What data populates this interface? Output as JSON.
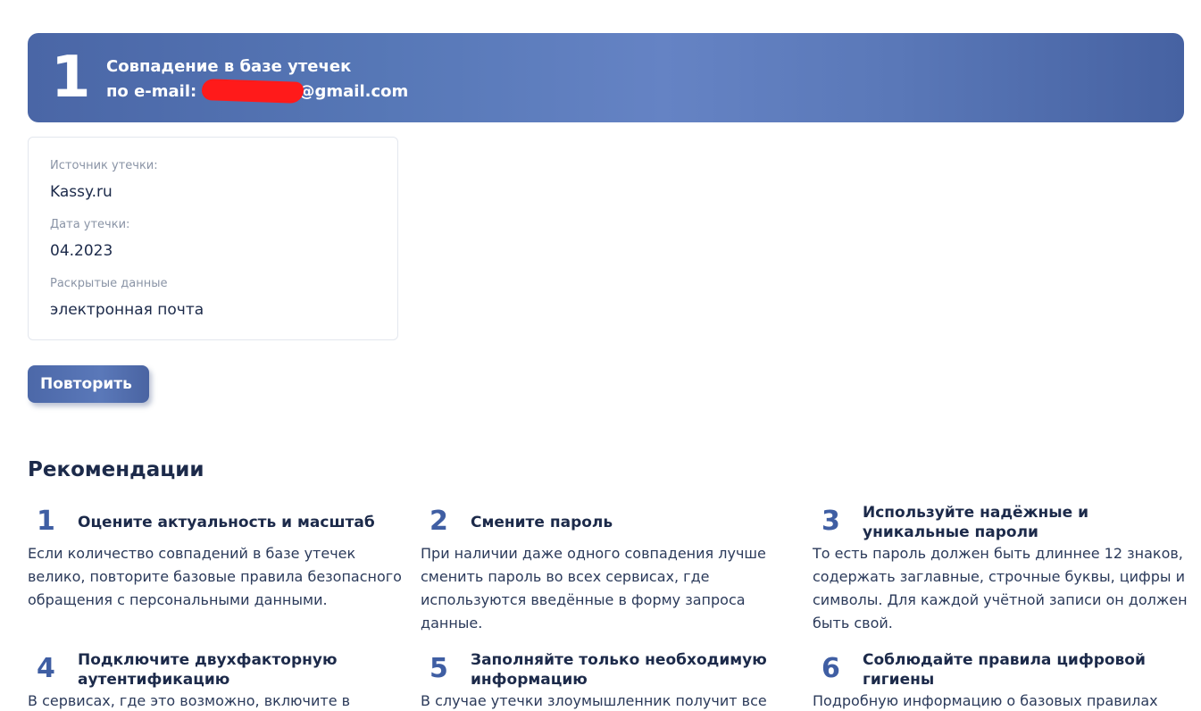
{
  "result": {
    "number": "1",
    "title_line1": "Совпадение в базе утечек",
    "title_prefix": "по e-mail:",
    "email_suffix": "@gmail.com"
  },
  "details": {
    "source_label": "Источник утечки:",
    "source_value": "Kassy.ru",
    "date_label": "Дата утечки:",
    "date_value": "04.2023",
    "data_label": "Раскрытые данные",
    "data_value": "электронная почта"
  },
  "actions": {
    "retry_label": "Повторить"
  },
  "recommendations": {
    "title": "Рекомендации",
    "items": [
      {
        "num": "1",
        "heading": "Оцените актуальность и масштаб",
        "text": "Если количество совпадений в базе утечек велико, повторите базовые правила безопасного обращения с персональными данными."
      },
      {
        "num": "2",
        "heading": "Смените пароль",
        "text": "При наличии даже одного совпадения лучше сменить пароль во всех сервисах, где используются введённые в форму запроса данные."
      },
      {
        "num": "3",
        "heading": "Используйте надёжные и уникальные пароли",
        "text": "То есть пароль должен быть длиннее 12 знаков, содержать заглавные, строчные буквы, цифры и символы. Для каждой учётной записи он должен быть свой."
      },
      {
        "num": "4",
        "heading": "Подключите двухфакторную аутентификацию",
        "text": "В сервисах, где это возможно, включите в"
      },
      {
        "num": "5",
        "heading": "Заполняйте только необходимую информацию",
        "text": "В случае утечки злоумышленник получит все"
      },
      {
        "num": "6",
        "heading": "Соблюдайте правила цифровой гигиены",
        "text": "Подробную информацию о базовых правилах"
      }
    ]
  }
}
